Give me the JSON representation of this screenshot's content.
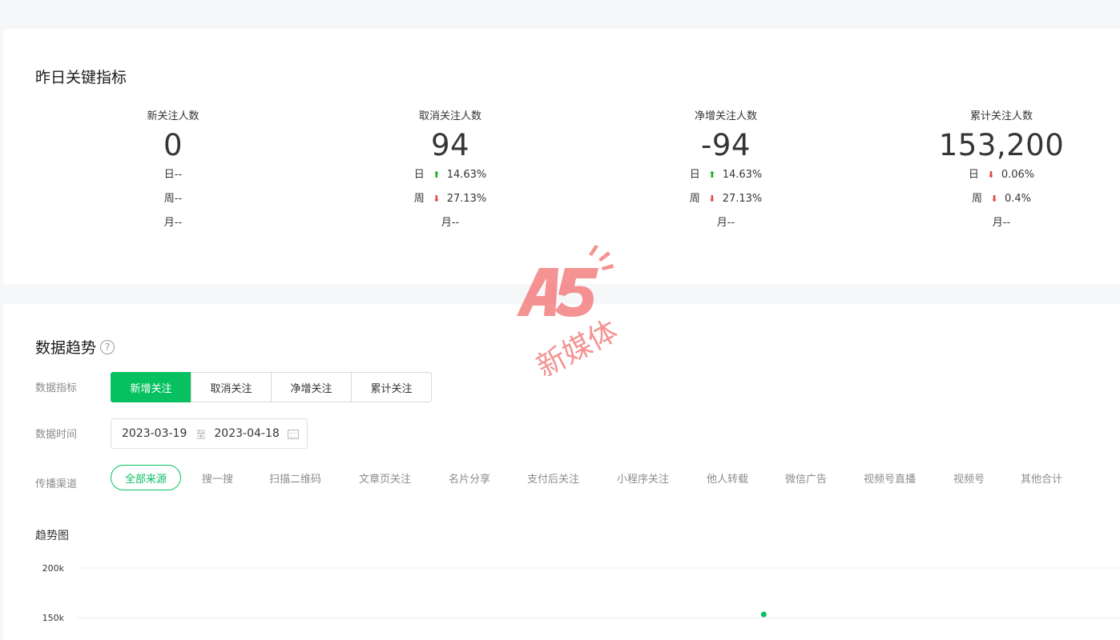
{
  "kpi_section": {
    "title": "昨日关键指标",
    "items": [
      {
        "label": "新关注人数",
        "value": "0",
        "rows": [
          {
            "text": "日--",
            "trend": "none",
            "pct": ""
          },
          {
            "text": "周--",
            "trend": "none",
            "pct": ""
          },
          {
            "text": "月--",
            "trend": "none",
            "pct": ""
          }
        ]
      },
      {
        "label": "取消关注人数",
        "value": "94",
        "rows": [
          {
            "text": "日",
            "trend": "up",
            "pct": "14.63%"
          },
          {
            "text": "周",
            "trend": "down",
            "pct": "27.13%"
          },
          {
            "text": "月--",
            "trend": "none",
            "pct": ""
          }
        ]
      },
      {
        "label": "净增关注人数",
        "value": "-94",
        "rows": [
          {
            "text": "日",
            "trend": "up",
            "pct": "14.63%"
          },
          {
            "text": "周",
            "trend": "down",
            "pct": "27.13%"
          },
          {
            "text": "月--",
            "trend": "none",
            "pct": ""
          }
        ]
      },
      {
        "label": "累计关注人数",
        "value": "153,200",
        "rows": [
          {
            "text": "日",
            "trend": "down",
            "pct": "0.06%"
          },
          {
            "text": "周",
            "trend": "down",
            "pct": "0.4%"
          },
          {
            "text": "月--",
            "trend": "none",
            "pct": ""
          }
        ]
      }
    ]
  },
  "trend_section": {
    "title": "数据趋势",
    "help_icon": "question-circle-icon",
    "metric_label": "数据指标",
    "metric_tabs": [
      "新增关注",
      "取消关注",
      "净增关注",
      "累计关注"
    ],
    "metric_active": 0,
    "time_label": "数据时间",
    "date_start": "2023-03-19",
    "date_sep": "至",
    "date_end": "2023-04-18",
    "calendar_icon": "calendar-icon",
    "channel_label": "传播渠道",
    "channels": [
      "全部来源",
      "搜一搜",
      "扫描二维码",
      "文章页关注",
      "名片分享",
      "支付后关注",
      "小程序关注",
      "他人转载",
      "微信广告",
      "视频号直播",
      "视频号",
      "其他合计"
    ],
    "channel_active": 0,
    "chart_title": "趋势图"
  },
  "chart_data": {
    "type": "line",
    "y_ticks": [
      "200k",
      "150k"
    ],
    "ylim": [
      150000,
      200000
    ],
    "points_visible": [
      {
        "x_fraction": 0.657,
        "y": 150000
      }
    ],
    "series_color": "#07c160",
    "grid": true
  },
  "watermark": {
    "brand": "A5",
    "text": "新媒体",
    "color": "#f15a5a"
  },
  "colors": {
    "accent": "#07c160",
    "up": "#1aad19",
    "down": "#e64340"
  }
}
